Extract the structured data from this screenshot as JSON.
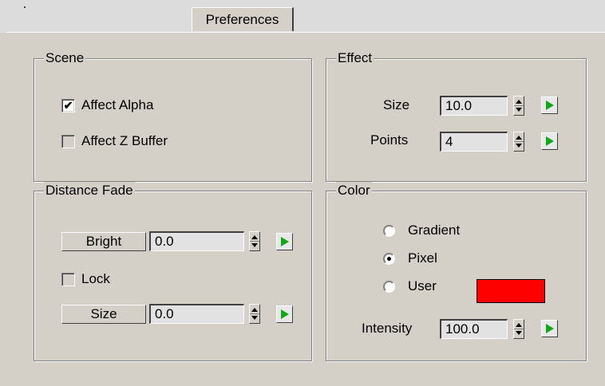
{
  "tabs": [
    {
      "label": "Preferences"
    }
  ],
  "scene": {
    "title": "Scene",
    "affect_alpha": {
      "label": "Affect Alpha",
      "checked": true
    },
    "affect_z_buffer": {
      "label": "Affect Z Buffer",
      "checked": false
    }
  },
  "effect": {
    "title": "Effect",
    "size": {
      "label": "Size",
      "value": "10.0"
    },
    "points": {
      "label": "Points",
      "value": "4"
    }
  },
  "distance_fade": {
    "title": "Distance Fade",
    "bright": {
      "label": "Bright",
      "value": "0.0"
    },
    "lock": {
      "label": "Lock",
      "checked": false
    },
    "size": {
      "label": "Size",
      "value": "0.0"
    }
  },
  "color": {
    "title": "Color",
    "options": [
      "Gradient",
      "Pixel",
      "User"
    ],
    "selected": "Pixel",
    "user_color": "#ff0000",
    "intensity": {
      "label": "Intensity",
      "value": "100.0"
    }
  },
  "icons": {
    "checkmark": "✔",
    "spinner": "spinner-up-down-icon",
    "animate": "green-arrow-key-icon"
  }
}
